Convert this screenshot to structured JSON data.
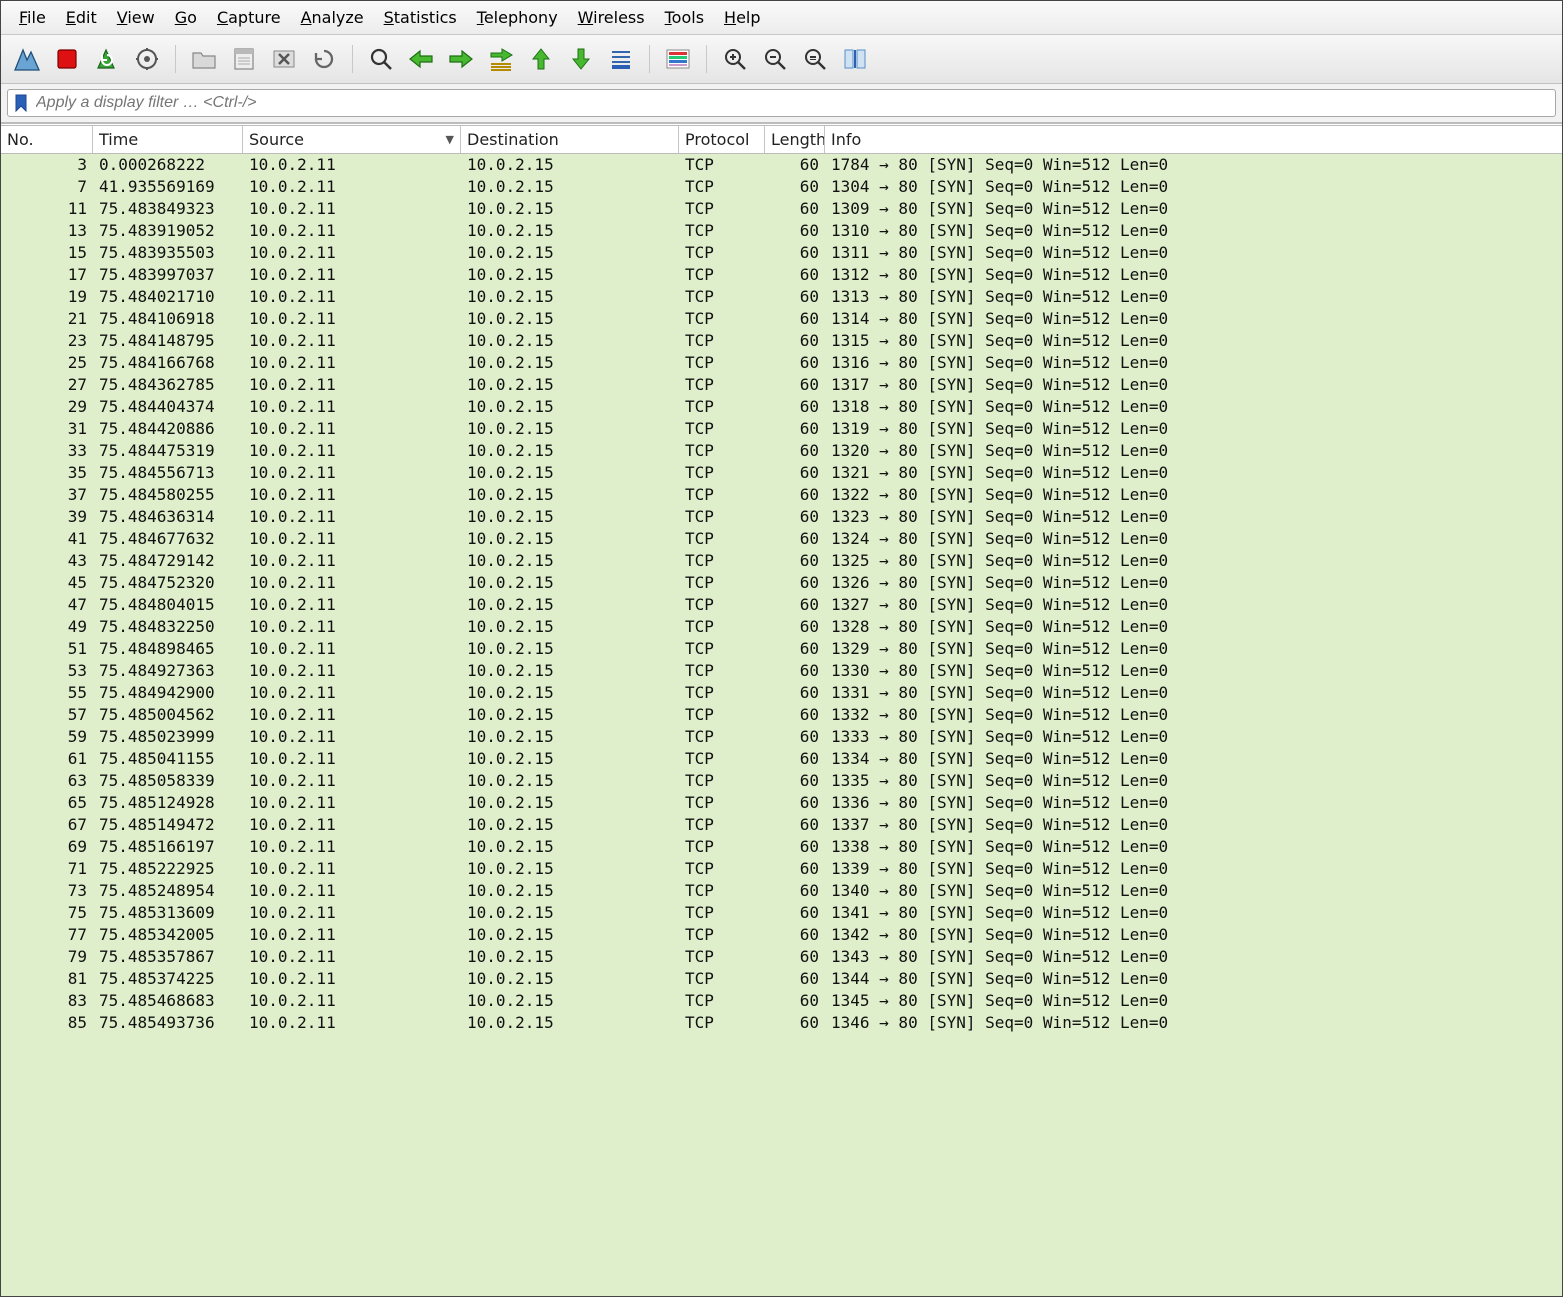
{
  "menu": [
    "File",
    "Edit",
    "View",
    "Go",
    "Capture",
    "Analyze",
    "Statistics",
    "Telephony",
    "Wireless",
    "Tools",
    "Help"
  ],
  "filter_placeholder": "Apply a display filter … <Ctrl-/>",
  "columns": {
    "no": "No.",
    "time": "Time",
    "source": "Source",
    "destination": "Destination",
    "protocol": "Protocol",
    "length": "Length",
    "info": "Info"
  },
  "packets": [
    {
      "no": 3,
      "time": "0.000268222",
      "src": "10.0.2.11",
      "dst": "10.0.2.15",
      "proto": "TCP",
      "len": 60,
      "info": "1784 → 80 [SYN] Seq=0 Win=512 Len=0"
    },
    {
      "no": 7,
      "time": "41.935569169",
      "src": "10.0.2.11",
      "dst": "10.0.2.15",
      "proto": "TCP",
      "len": 60,
      "info": "1304 → 80 [SYN] Seq=0 Win=512 Len=0"
    },
    {
      "no": 11,
      "time": "75.483849323",
      "src": "10.0.2.11",
      "dst": "10.0.2.15",
      "proto": "TCP",
      "len": 60,
      "info": "1309 → 80 [SYN] Seq=0 Win=512 Len=0"
    },
    {
      "no": 13,
      "time": "75.483919052",
      "src": "10.0.2.11",
      "dst": "10.0.2.15",
      "proto": "TCP",
      "len": 60,
      "info": "1310 → 80 [SYN] Seq=0 Win=512 Len=0"
    },
    {
      "no": 15,
      "time": "75.483935503",
      "src": "10.0.2.11",
      "dst": "10.0.2.15",
      "proto": "TCP",
      "len": 60,
      "info": "1311 → 80 [SYN] Seq=0 Win=512 Len=0"
    },
    {
      "no": 17,
      "time": "75.483997037",
      "src": "10.0.2.11",
      "dst": "10.0.2.15",
      "proto": "TCP",
      "len": 60,
      "info": "1312 → 80 [SYN] Seq=0 Win=512 Len=0"
    },
    {
      "no": 19,
      "time": "75.484021710",
      "src": "10.0.2.11",
      "dst": "10.0.2.15",
      "proto": "TCP",
      "len": 60,
      "info": "1313 → 80 [SYN] Seq=0 Win=512 Len=0"
    },
    {
      "no": 21,
      "time": "75.484106918",
      "src": "10.0.2.11",
      "dst": "10.0.2.15",
      "proto": "TCP",
      "len": 60,
      "info": "1314 → 80 [SYN] Seq=0 Win=512 Len=0"
    },
    {
      "no": 23,
      "time": "75.484148795",
      "src": "10.0.2.11",
      "dst": "10.0.2.15",
      "proto": "TCP",
      "len": 60,
      "info": "1315 → 80 [SYN] Seq=0 Win=512 Len=0"
    },
    {
      "no": 25,
      "time": "75.484166768",
      "src": "10.0.2.11",
      "dst": "10.0.2.15",
      "proto": "TCP",
      "len": 60,
      "info": "1316 → 80 [SYN] Seq=0 Win=512 Len=0"
    },
    {
      "no": 27,
      "time": "75.484362785",
      "src": "10.0.2.11",
      "dst": "10.0.2.15",
      "proto": "TCP",
      "len": 60,
      "info": "1317 → 80 [SYN] Seq=0 Win=512 Len=0"
    },
    {
      "no": 29,
      "time": "75.484404374",
      "src": "10.0.2.11",
      "dst": "10.0.2.15",
      "proto": "TCP",
      "len": 60,
      "info": "1318 → 80 [SYN] Seq=0 Win=512 Len=0"
    },
    {
      "no": 31,
      "time": "75.484420886",
      "src": "10.0.2.11",
      "dst": "10.0.2.15",
      "proto": "TCP",
      "len": 60,
      "info": "1319 → 80 [SYN] Seq=0 Win=512 Len=0"
    },
    {
      "no": 33,
      "time": "75.484475319",
      "src": "10.0.2.11",
      "dst": "10.0.2.15",
      "proto": "TCP",
      "len": 60,
      "info": "1320 → 80 [SYN] Seq=0 Win=512 Len=0"
    },
    {
      "no": 35,
      "time": "75.484556713",
      "src": "10.0.2.11",
      "dst": "10.0.2.15",
      "proto": "TCP",
      "len": 60,
      "info": "1321 → 80 [SYN] Seq=0 Win=512 Len=0"
    },
    {
      "no": 37,
      "time": "75.484580255",
      "src": "10.0.2.11",
      "dst": "10.0.2.15",
      "proto": "TCP",
      "len": 60,
      "info": "1322 → 80 [SYN] Seq=0 Win=512 Len=0"
    },
    {
      "no": 39,
      "time": "75.484636314",
      "src": "10.0.2.11",
      "dst": "10.0.2.15",
      "proto": "TCP",
      "len": 60,
      "info": "1323 → 80 [SYN] Seq=0 Win=512 Len=0"
    },
    {
      "no": 41,
      "time": "75.484677632",
      "src": "10.0.2.11",
      "dst": "10.0.2.15",
      "proto": "TCP",
      "len": 60,
      "info": "1324 → 80 [SYN] Seq=0 Win=512 Len=0"
    },
    {
      "no": 43,
      "time": "75.484729142",
      "src": "10.0.2.11",
      "dst": "10.0.2.15",
      "proto": "TCP",
      "len": 60,
      "info": "1325 → 80 [SYN] Seq=0 Win=512 Len=0"
    },
    {
      "no": 45,
      "time": "75.484752320",
      "src": "10.0.2.11",
      "dst": "10.0.2.15",
      "proto": "TCP",
      "len": 60,
      "info": "1326 → 80 [SYN] Seq=0 Win=512 Len=0"
    },
    {
      "no": 47,
      "time": "75.484804015",
      "src": "10.0.2.11",
      "dst": "10.0.2.15",
      "proto": "TCP",
      "len": 60,
      "info": "1327 → 80 [SYN] Seq=0 Win=512 Len=0"
    },
    {
      "no": 49,
      "time": "75.484832250",
      "src": "10.0.2.11",
      "dst": "10.0.2.15",
      "proto": "TCP",
      "len": 60,
      "info": "1328 → 80 [SYN] Seq=0 Win=512 Len=0"
    },
    {
      "no": 51,
      "time": "75.484898465",
      "src": "10.0.2.11",
      "dst": "10.0.2.15",
      "proto": "TCP",
      "len": 60,
      "info": "1329 → 80 [SYN] Seq=0 Win=512 Len=0"
    },
    {
      "no": 53,
      "time": "75.484927363",
      "src": "10.0.2.11",
      "dst": "10.0.2.15",
      "proto": "TCP",
      "len": 60,
      "info": "1330 → 80 [SYN] Seq=0 Win=512 Len=0"
    },
    {
      "no": 55,
      "time": "75.484942900",
      "src": "10.0.2.11",
      "dst": "10.0.2.15",
      "proto": "TCP",
      "len": 60,
      "info": "1331 → 80 [SYN] Seq=0 Win=512 Len=0"
    },
    {
      "no": 57,
      "time": "75.485004562",
      "src": "10.0.2.11",
      "dst": "10.0.2.15",
      "proto": "TCP",
      "len": 60,
      "info": "1332 → 80 [SYN] Seq=0 Win=512 Len=0"
    },
    {
      "no": 59,
      "time": "75.485023999",
      "src": "10.0.2.11",
      "dst": "10.0.2.15",
      "proto": "TCP",
      "len": 60,
      "info": "1333 → 80 [SYN] Seq=0 Win=512 Len=0"
    },
    {
      "no": 61,
      "time": "75.485041155",
      "src": "10.0.2.11",
      "dst": "10.0.2.15",
      "proto": "TCP",
      "len": 60,
      "info": "1334 → 80 [SYN] Seq=0 Win=512 Len=0"
    },
    {
      "no": 63,
      "time": "75.485058339",
      "src": "10.0.2.11",
      "dst": "10.0.2.15",
      "proto": "TCP",
      "len": 60,
      "info": "1335 → 80 [SYN] Seq=0 Win=512 Len=0"
    },
    {
      "no": 65,
      "time": "75.485124928",
      "src": "10.0.2.11",
      "dst": "10.0.2.15",
      "proto": "TCP",
      "len": 60,
      "info": "1336 → 80 [SYN] Seq=0 Win=512 Len=0"
    },
    {
      "no": 67,
      "time": "75.485149472",
      "src": "10.0.2.11",
      "dst": "10.0.2.15",
      "proto": "TCP",
      "len": 60,
      "info": "1337 → 80 [SYN] Seq=0 Win=512 Len=0"
    },
    {
      "no": 69,
      "time": "75.485166197",
      "src": "10.0.2.11",
      "dst": "10.0.2.15",
      "proto": "TCP",
      "len": 60,
      "info": "1338 → 80 [SYN] Seq=0 Win=512 Len=0"
    },
    {
      "no": 71,
      "time": "75.485222925",
      "src": "10.0.2.11",
      "dst": "10.0.2.15",
      "proto": "TCP",
      "len": 60,
      "info": "1339 → 80 [SYN] Seq=0 Win=512 Len=0"
    },
    {
      "no": 73,
      "time": "75.485248954",
      "src": "10.0.2.11",
      "dst": "10.0.2.15",
      "proto": "TCP",
      "len": 60,
      "info": "1340 → 80 [SYN] Seq=0 Win=512 Len=0"
    },
    {
      "no": 75,
      "time": "75.485313609",
      "src": "10.0.2.11",
      "dst": "10.0.2.15",
      "proto": "TCP",
      "len": 60,
      "info": "1341 → 80 [SYN] Seq=0 Win=512 Len=0"
    },
    {
      "no": 77,
      "time": "75.485342005",
      "src": "10.0.2.11",
      "dst": "10.0.2.15",
      "proto": "TCP",
      "len": 60,
      "info": "1342 → 80 [SYN] Seq=0 Win=512 Len=0"
    },
    {
      "no": 79,
      "time": "75.485357867",
      "src": "10.0.2.11",
      "dst": "10.0.2.15",
      "proto": "TCP",
      "len": 60,
      "info": "1343 → 80 [SYN] Seq=0 Win=512 Len=0"
    },
    {
      "no": 81,
      "time": "75.485374225",
      "src": "10.0.2.11",
      "dst": "10.0.2.15",
      "proto": "TCP",
      "len": 60,
      "info": "1344 → 80 [SYN] Seq=0 Win=512 Len=0"
    },
    {
      "no": 83,
      "time": "75.485468683",
      "src": "10.0.2.11",
      "dst": "10.0.2.15",
      "proto": "TCP",
      "len": 60,
      "info": "1345 → 80 [SYN] Seq=0 Win=512 Len=0"
    },
    {
      "no": 85,
      "time": "75.485493736",
      "src": "10.0.2.11",
      "dst": "10.0.2.15",
      "proto": "TCP",
      "len": 60,
      "info": "1346 → 80 [SYN] Seq=0 Win=512 Len=0"
    }
  ]
}
